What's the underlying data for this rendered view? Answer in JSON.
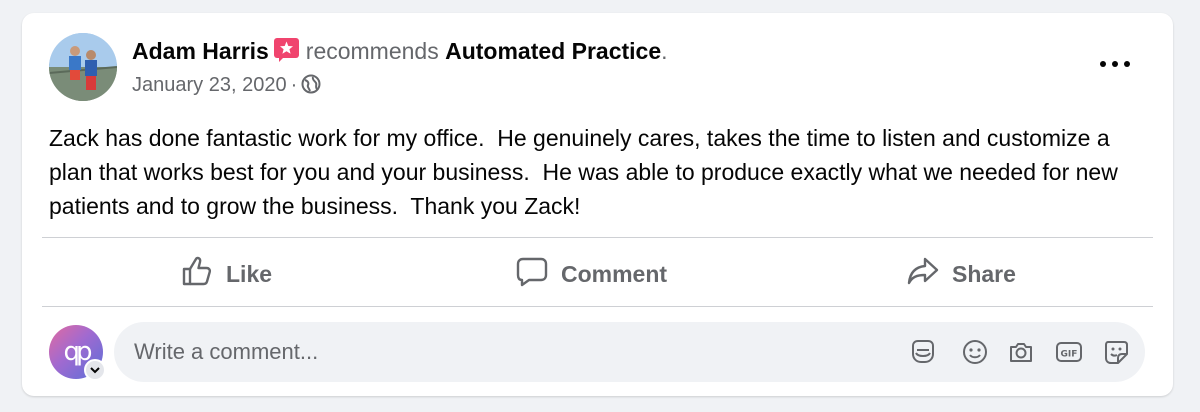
{
  "post": {
    "author": "Adam Harris",
    "verb": "recommends",
    "page": "Automated Practice",
    "end_punct": ".",
    "date": "January 23, 2020",
    "separator": "·",
    "text": "Zack has done fantastic work for my office.  He genuinely cares, takes the time to listen and customize a plan that works best for you and your business.  He was able to produce exactly what we needed for new patients and to grow the business.  Thank you Zack!"
  },
  "actions": {
    "like": "Like",
    "comment": "Comment",
    "share": "Share"
  },
  "composer": {
    "placeholder": "Write a comment...",
    "avatar_monogram": "qp",
    "tools": [
      "sticker-bubble-icon",
      "emoji-icon",
      "camera-icon",
      "gif-icon",
      "sticker-icon"
    ]
  },
  "colors": {
    "recommend_badge": "#f0446e",
    "secondary_text": "#65676b",
    "page_bg": "#f0f2f5"
  }
}
